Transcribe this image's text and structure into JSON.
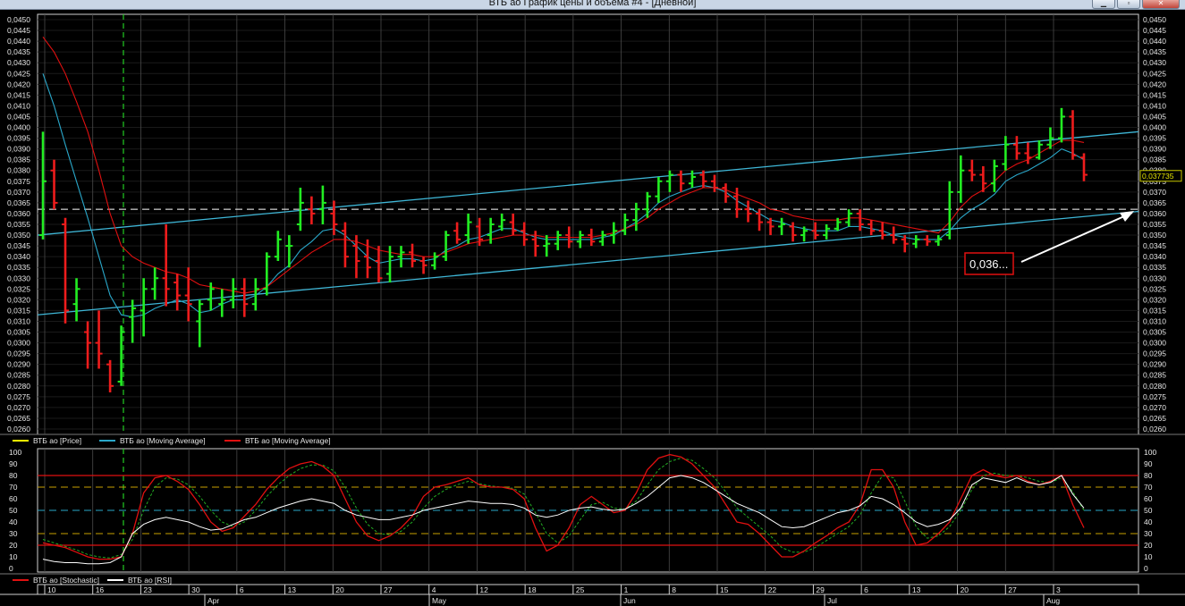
{
  "window": {
    "title": "ВТБ ао График цены и объёма #4 - [Дневной]",
    "buttons": {
      "minimize": "▁",
      "maximize": "▫",
      "close": "✕"
    }
  },
  "price_panel": {
    "y_ticks": [
      "0,0450",
      "0,0445",
      "0,0440",
      "0,0435",
      "0,0430",
      "0,0425",
      "0,0420",
      "0,0415",
      "0,0410",
      "0,0405",
      "0,0400",
      "0,0395",
      "0,0390",
      "0,0385",
      "0,0380",
      "0,0375",
      "0,0370",
      "0,0365",
      "0,0360",
      "0,0355",
      "0,0350",
      "0,0345",
      "0,0340",
      "0,0335",
      "0,0330",
      "0,0325",
      "0,0320",
      "0,0315",
      "0,0310",
      "0,0305",
      "0,0300",
      "0,0295",
      "0,0290",
      "0,0285",
      "0,0280",
      "0,0275",
      "0,0270",
      "0,0265",
      "0,0260"
    ],
    "last_price_label": "0,037735",
    "annotation": "0,036...",
    "legend": [
      {
        "label": "ВТБ ао [Price]",
        "color": "#ffff00"
      },
      {
        "label": "ВТБ ао [Moving Average]",
        "color": "#2aa7c9"
      },
      {
        "label": "ВТБ ао [Moving Average]",
        "color": "#e01010"
      }
    ]
  },
  "osc_panel": {
    "y_ticks": [
      "100",
      "90",
      "80",
      "70",
      "60",
      "50",
      "40",
      "30",
      "20",
      "10",
      "0"
    ],
    "legend": [
      {
        "label": "ВТБ ао [Stochastic]",
        "color": "#e01010"
      },
      {
        "label": "ВТБ ао [RSI]",
        "color": "#ffffff"
      }
    ]
  },
  "time_axis": {
    "days": [
      "10",
      "16",
      "23",
      "30",
      "6",
      "13",
      "20",
      "27",
      "4",
      "12",
      "18",
      "25",
      "1",
      "8",
      "15",
      "22",
      "29",
      "6",
      "13",
      "20",
      "27",
      "3"
    ],
    "months": [
      "Apr",
      "May",
      "Jun",
      "Jul",
      "Aug"
    ]
  },
  "colors": {
    "bull": "#22ee22",
    "bear": "#ee1c1c",
    "ma_fast": "#2aa7c9",
    "ma_slow": "#e01010",
    "channel": "#3fb7d7",
    "grid": "#4a4a4a",
    "panel_bg": "#000000",
    "frame": "#d0d0d0"
  },
  "chart_data": {
    "type": "candlestick",
    "y_range": [
      0.026,
      0.045
    ],
    "support_level": 0.0362,
    "bars": [
      [
        0.035,
        0.0398,
        0.0348,
        0.0375
      ],
      [
        0.038,
        0.0385,
        0.0362,
        0.0365
      ],
      [
        0.0355,
        0.0358,
        0.0309,
        0.0315
      ],
      [
        0.0318,
        0.033,
        0.031,
        0.0325
      ],
      [
        0.0305,
        0.031,
        0.0288,
        0.03
      ],
      [
        0.03,
        0.0315,
        0.0288,
        0.0295
      ],
      [
        0.029,
        0.0292,
        0.0277,
        0.028
      ],
      [
        0.0282,
        0.0308,
        0.028,
        0.0305
      ],
      [
        0.0312,
        0.032,
        0.03,
        0.0316
      ],
      [
        0.0315,
        0.033,
        0.0303,
        0.0325
      ],
      [
        0.0325,
        0.0335,
        0.032,
        0.033
      ],
      [
        0.033,
        0.0355,
        0.0317,
        0.0325
      ],
      [
        0.0328,
        0.0332,
        0.0315,
        0.0322
      ],
      [
        0.0322,
        0.0335,
        0.031,
        0.0318
      ],
      [
        0.031,
        0.032,
        0.0298,
        0.0318
      ],
      [
        0.032,
        0.0328,
        0.0315,
        0.0325
      ],
      [
        0.0318,
        0.0325,
        0.0312,
        0.032
      ],
      [
        0.032,
        0.033,
        0.0316,
        0.0325
      ],
      [
        0.0325,
        0.033,
        0.0312,
        0.0318
      ],
      [
        0.0318,
        0.033,
        0.0315,
        0.0325
      ],
      [
        0.0325,
        0.0342,
        0.0322,
        0.034
      ],
      [
        0.034,
        0.0352,
        0.0338,
        0.0348
      ],
      [
        0.0345,
        0.035,
        0.0335,
        0.0345
      ],
      [
        0.0355,
        0.0372,
        0.0352,
        0.0365
      ],
      [
        0.0362,
        0.0368,
        0.0355,
        0.036
      ],
      [
        0.0362,
        0.0373,
        0.0355,
        0.0365
      ],
      [
        0.036,
        0.0366,
        0.035,
        0.0355
      ],
      [
        0.0352,
        0.0356,
        0.0335,
        0.034
      ],
      [
        0.0345,
        0.035,
        0.033,
        0.0338
      ],
      [
        0.034,
        0.0348,
        0.033,
        0.0335
      ],
      [
        0.0338,
        0.0345,
        0.0328,
        0.033
      ],
      [
        0.0332,
        0.0345,
        0.0328,
        0.034
      ],
      [
        0.034,
        0.0345,
        0.0335,
        0.0342
      ],
      [
        0.0342,
        0.0346,
        0.0335,
        0.0338
      ],
      [
        0.0338,
        0.034,
        0.0332,
        0.0336
      ],
      [
        0.0336,
        0.0342,
        0.0334,
        0.034
      ],
      [
        0.034,
        0.0352,
        0.0338,
        0.035
      ],
      [
        0.0352,
        0.0356,
        0.0346,
        0.0348
      ],
      [
        0.035,
        0.036,
        0.0346,
        0.0356
      ],
      [
        0.0354,
        0.0358,
        0.0345,
        0.0348
      ],
      [
        0.035,
        0.0358,
        0.0346,
        0.0355
      ],
      [
        0.0354,
        0.036,
        0.0352,
        0.0357
      ],
      [
        0.0356,
        0.036,
        0.035,
        0.0352
      ],
      [
        0.0352,
        0.0356,
        0.0345,
        0.0348
      ],
      [
        0.0348,
        0.0352,
        0.034,
        0.0345
      ],
      [
        0.0345,
        0.035,
        0.034,
        0.0346
      ],
      [
        0.0346,
        0.0352,
        0.0343,
        0.035
      ],
      [
        0.035,
        0.0354,
        0.0344,
        0.0347
      ],
      [
        0.0347,
        0.0352,
        0.0344,
        0.035
      ],
      [
        0.035,
        0.0353,
        0.0345,
        0.0347
      ],
      [
        0.0347,
        0.0352,
        0.0345,
        0.035
      ],
      [
        0.035,
        0.0356,
        0.0346,
        0.0352
      ],
      [
        0.0352,
        0.036,
        0.035,
        0.0357
      ],
      [
        0.0357,
        0.0365,
        0.0352,
        0.0362
      ],
      [
        0.0362,
        0.037,
        0.0358,
        0.0368
      ],
      [
        0.0368,
        0.0377,
        0.0365,
        0.0375
      ],
      [
        0.0375,
        0.038,
        0.037,
        0.0378
      ],
      [
        0.0378,
        0.038,
        0.037,
        0.0374
      ],
      [
        0.0374,
        0.038,
        0.0372,
        0.0377
      ],
      [
        0.0378,
        0.038,
        0.0372,
        0.0375
      ],
      [
        0.0375,
        0.0378,
        0.037,
        0.0372
      ],
      [
        0.0372,
        0.0374,
        0.0365,
        0.0368
      ],
      [
        0.0368,
        0.0372,
        0.0358,
        0.0362
      ],
      [
        0.0362,
        0.0366,
        0.0356,
        0.036
      ],
      [
        0.036,
        0.0362,
        0.0352,
        0.0356
      ],
      [
        0.0356,
        0.0358,
        0.035,
        0.0354
      ],
      [
        0.0354,
        0.0358,
        0.035,
        0.0355
      ],
      [
        0.0354,
        0.0356,
        0.0347,
        0.035
      ],
      [
        0.035,
        0.0354,
        0.0347,
        0.0352
      ],
      [
        0.0352,
        0.0356,
        0.0348,
        0.035
      ],
      [
        0.035,
        0.0355,
        0.0348,
        0.0353
      ],
      [
        0.0353,
        0.0358,
        0.0352,
        0.0356
      ],
      [
        0.0356,
        0.0362,
        0.0354,
        0.036
      ],
      [
        0.036,
        0.0362,
        0.0352,
        0.0355
      ],
      [
        0.0355,
        0.0357,
        0.035,
        0.0352
      ],
      [
        0.0352,
        0.0356,
        0.0348,
        0.035
      ],
      [
        0.035,
        0.0354,
        0.0346,
        0.0348
      ],
      [
        0.0348,
        0.035,
        0.0342,
        0.0346
      ],
      [
        0.0346,
        0.035,
        0.0344,
        0.0348
      ],
      [
        0.0348,
        0.035,
        0.0345,
        0.0347
      ],
      [
        0.0347,
        0.035,
        0.0345,
        0.0348
      ],
      [
        0.035,
        0.0375,
        0.0348,
        0.037
      ],
      [
        0.037,
        0.0387,
        0.0365,
        0.038
      ],
      [
        0.038,
        0.0385,
        0.0375,
        0.0378
      ],
      [
        0.0378,
        0.0382,
        0.037,
        0.0374
      ],
      [
        0.0374,
        0.0385,
        0.037,
        0.0382
      ],
      [
        0.0383,
        0.0396,
        0.038,
        0.0392
      ],
      [
        0.0392,
        0.0396,
        0.0385,
        0.0388
      ],
      [
        0.0388,
        0.0393,
        0.0383,
        0.0386
      ],
      [
        0.0386,
        0.0394,
        0.0385,
        0.0392
      ],
      [
        0.0392,
        0.04,
        0.039,
        0.0395
      ],
      [
        0.0395,
        0.0409,
        0.0393,
        0.0405
      ],
      [
        0.0405,
        0.0408,
        0.0385,
        0.0387
      ],
      [
        0.0386,
        0.0388,
        0.0375,
        0.0378
      ]
    ],
    "ma_fast": [
      0.0425,
      0.041,
      0.0392,
      0.0375,
      0.0358,
      0.034,
      0.0322,
      0.0313,
      0.0312,
      0.0313,
      0.0316,
      0.0318,
      0.032,
      0.0318,
      0.0314,
      0.0315,
      0.0318,
      0.032,
      0.032,
      0.0322,
      0.0326,
      0.0332,
      0.0336,
      0.0343,
      0.0347,
      0.0352,
      0.0353,
      0.035,
      0.0345,
      0.034,
      0.0337,
      0.0338,
      0.0339,
      0.0339,
      0.0338,
      0.0339,
      0.0343,
      0.0345,
      0.0348,
      0.0349,
      0.0351,
      0.0353,
      0.0353,
      0.0351,
      0.0349,
      0.0348,
      0.0348,
      0.0348,
      0.0348,
      0.0348,
      0.0349,
      0.035,
      0.0353,
      0.0356,
      0.036,
      0.0365,
      0.0368,
      0.037,
      0.0372,
      0.0373,
      0.0372,
      0.037,
      0.0366,
      0.0363,
      0.036,
      0.0357,
      0.0356,
      0.0354,
      0.0353,
      0.0352,
      0.0352,
      0.0352,
      0.0354,
      0.0354,
      0.0353,
      0.0352,
      0.035,
      0.0349,
      0.0348,
      0.0348,
      0.0348,
      0.0352,
      0.0358,
      0.0362,
      0.0365,
      0.0369,
      0.0375,
      0.0378,
      0.038,
      0.0383,
      0.0386,
      0.039,
      0.0388,
      0.0385
    ],
    "ma_slow": [
      0.0442,
      0.0435,
      0.0425,
      0.0412,
      0.0398,
      0.038,
      0.036,
      0.0345,
      0.034,
      0.0337,
      0.0335,
      0.0333,
      0.0332,
      0.033,
      0.0327,
      0.0326,
      0.0325,
      0.0324,
      0.0323,
      0.0324,
      0.0326,
      0.033,
      0.0334,
      0.0338,
      0.0342,
      0.0345,
      0.0348,
      0.0348,
      0.0347,
      0.0345,
      0.0343,
      0.0342,
      0.0341,
      0.0341,
      0.034,
      0.034,
      0.0342,
      0.0344,
      0.0346,
      0.0347,
      0.0348,
      0.0349,
      0.035,
      0.035,
      0.035,
      0.0349,
      0.0349,
      0.0349,
      0.0349,
      0.0349,
      0.035,
      0.0351,
      0.0353,
      0.0355,
      0.0358,
      0.0362,
      0.0365,
      0.0368,
      0.037,
      0.0372,
      0.0372,
      0.0371,
      0.0369,
      0.0367,
      0.0365,
      0.0362,
      0.0361,
      0.0359,
      0.0358,
      0.0357,
      0.0357,
      0.0357,
      0.0358,
      0.0358,
      0.0357,
      0.0356,
      0.0355,
      0.0354,
      0.0353,
      0.0352,
      0.0351,
      0.0356,
      0.0363,
      0.0368,
      0.0371,
      0.0375,
      0.038,
      0.0383,
      0.0385,
      0.0388,
      0.0391,
      0.0394,
      0.0394,
      0.0393
    ],
    "channel_upper": [
      [
        0.035,
        0.0398
      ]
    ],
    "channel_lower": [
      [
        0.0313,
        0.0361
      ]
    ],
    "stochastic": [
      22,
      20,
      18,
      14,
      10,
      8,
      8,
      10,
      30,
      65,
      78,
      80,
      75,
      68,
      55,
      40,
      32,
      35,
      45,
      55,
      68,
      78,
      86,
      90,
      92,
      88,
      80,
      60,
      40,
      28,
      24,
      28,
      35,
      45,
      62,
      70,
      72,
      75,
      78,
      72,
      70,
      70,
      68,
      60,
      35,
      15,
      20,
      35,
      55,
      62,
      55,
      48,
      50,
      65,
      85,
      95,
      98,
      96,
      90,
      80,
      70,
      55,
      40,
      38,
      30,
      20,
      10,
      10,
      15,
      22,
      28,
      35,
      40,
      55,
      85,
      85,
      70,
      40,
      20,
      22,
      30,
      40,
      60,
      80,
      85,
      80,
      78,
      80,
      75,
      72,
      75,
      80,
      55,
      35
    ],
    "stoch_signal": [
      25,
      22,
      19,
      16,
      12,
      10,
      9,
      12,
      25,
      50,
      70,
      78,
      77,
      72,
      62,
      50,
      40,
      36,
      40,
      50,
      62,
      72,
      80,
      86,
      89,
      89,
      84,
      70,
      52,
      38,
      30,
      29,
      32,
      40,
      52,
      62,
      68,
      72,
      75,
      73,
      71,
      70,
      69,
      64,
      48,
      30,
      22,
      28,
      42,
      55,
      57,
      52,
      51,
      58,
      72,
      85,
      92,
      95,
      93,
      86,
      78,
      66,
      52,
      44,
      36,
      28,
      18,
      14,
      14,
      18,
      24,
      30,
      36,
      46,
      65,
      80,
      78,
      58,
      36,
      26,
      28,
      36,
      50,
      68,
      80,
      82,
      80,
      80,
      78,
      75,
      74,
      78,
      66,
      50
    ],
    "rsi": [
      8,
      6,
      5,
      5,
      4,
      4,
      5,
      10,
      30,
      38,
      42,
      44,
      42,
      40,
      36,
      33,
      34,
      38,
      42,
      44,
      48,
      52,
      55,
      58,
      60,
      58,
      56,
      50,
      46,
      44,
      42,
      42,
      44,
      46,
      50,
      52,
      54,
      56,
      58,
      57,
      56,
      56,
      55,
      52,
      46,
      44,
      46,
      50,
      52,
      53,
      51,
      50,
      51,
      56,
      62,
      70,
      78,
      80,
      78,
      74,
      68,
      62,
      56,
      52,
      48,
      42,
      36,
      35,
      36,
      40,
      44,
      48,
      50,
      54,
      62,
      60,
      55,
      48,
      40,
      36,
      38,
      42,
      52,
      72,
      78,
      76,
      74,
      78,
      74,
      72,
      74,
      80,
      64,
      52
    ],
    "stoch_levels": [
      80,
      20
    ],
    "rsi_levels": [
      70,
      30
    ],
    "mid_level": 50
  }
}
